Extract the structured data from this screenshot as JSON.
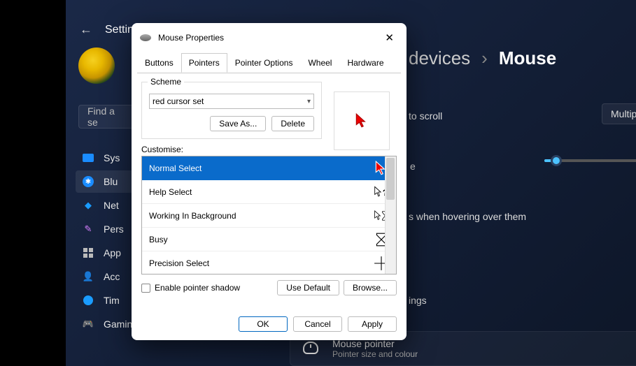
{
  "settings": {
    "back_icon": "←",
    "title": "Settings",
    "search_placeholder": "Find a se",
    "nav": {
      "system": "Sys",
      "bluetooth": "Blu",
      "network": "Net",
      "personalisation": "Pers",
      "apps": "App",
      "accounts": "Acc",
      "time": "Tim",
      "gaming": "Gaming"
    },
    "breadcrumb": {
      "devices": "devices",
      "sep": "›",
      "mouse": "Mouse"
    },
    "scroll_hint": "to scroll",
    "multi_btn": "Multip",
    "hover_line": "when hovering over them",
    "ings_line": "ings",
    "card": {
      "title": "Mouse pointer",
      "sub": "Pointer size and colour"
    }
  },
  "dialog": {
    "title": "Mouse Properties",
    "close": "✕",
    "tabs": {
      "buttons": "Buttons",
      "pointers": "Pointers",
      "pointer_options": "Pointer Options",
      "wheel": "Wheel",
      "hardware": "Hardware"
    },
    "scheme": {
      "label": "Scheme",
      "value": "red cursor set",
      "save_as": "Save As...",
      "delete": "Delete"
    },
    "customise_label": "Customise:",
    "list": [
      {
        "label": "Normal Select",
        "icon": "arrow-red",
        "selected": true
      },
      {
        "label": "Help Select",
        "icon": "arrow-help",
        "selected": false
      },
      {
        "label": "Working In Background",
        "icon": "arrow-busy",
        "selected": false
      },
      {
        "label": "Busy",
        "icon": "hourglass",
        "selected": false
      },
      {
        "label": "Precision Select",
        "icon": "cross",
        "selected": false
      }
    ],
    "shadow_label": "Enable pointer shadow",
    "use_default": "Use Default",
    "browse": "Browse...",
    "ok": "OK",
    "cancel": "Cancel",
    "apply": "Apply"
  }
}
